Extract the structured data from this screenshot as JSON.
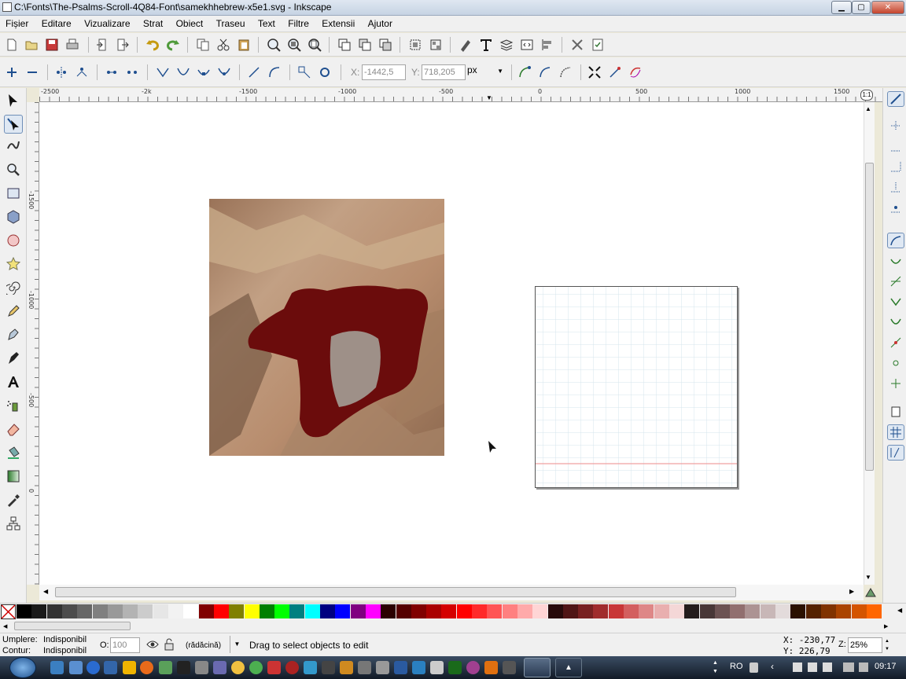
{
  "window": {
    "title": "C:\\Fonts\\The-Psalms-Scroll-4Q84-Font\\samekhhebrew-x5e1.svg - Inkscape",
    "min": "▁",
    "max": "▢",
    "close": "✕"
  },
  "menu": [
    "Fișier",
    "Editare",
    "Vizualizare",
    "Strat",
    "Obiect",
    "Traseu",
    "Text",
    "Filtre",
    "Extensii",
    "Ajutor"
  ],
  "node_toolbar": {
    "x_label": "X:",
    "x_value": "-1442,5",
    "y_label": "Y:",
    "y_value": "718,205",
    "unit": "px"
  },
  "ruler_top": [
    "-2500",
    "-2k",
    "-1500",
    "-1000",
    "-500",
    "0",
    "500",
    "1000",
    "1500"
  ],
  "ruler_left": [
    "-1500",
    "-1000",
    "-500",
    "0"
  ],
  "palette_colors": [
    "#000000",
    "#1a1a1a",
    "#333333",
    "#4d4d4d",
    "#666666",
    "#808080",
    "#999999",
    "#b3b3b3",
    "#cccccc",
    "#e6e6e6",
    "#f2f2f2",
    "#ffffff",
    "#800000",
    "#ff0000",
    "#808000",
    "#ffff00",
    "#008000",
    "#00ff00",
    "#008080",
    "#00ffff",
    "#000080",
    "#0000ff",
    "#800080",
    "#ff00ff",
    "#2b0000",
    "#550000",
    "#800000",
    "#aa0000",
    "#d40000",
    "#ff0000",
    "#ff2a2a",
    "#ff5555",
    "#ff8080",
    "#ffaaaa",
    "#ffd5d5",
    "#280b0b",
    "#501616",
    "#782121",
    "#a02c2c",
    "#c83737",
    "#d35f5f",
    "#de8787",
    "#e9afaf",
    "#f4d7d7",
    "#241c1c",
    "#483737",
    "#6c5353",
    "#916f6f",
    "#ac9393",
    "#c8b7b7",
    "#e3dbdb",
    "#2b1100",
    "#552200",
    "#803300",
    "#aa4400",
    "#d45500",
    "#ff6600"
  ],
  "status": {
    "fill_label": "Umplere:",
    "fill_value": "Indisponibil",
    "stroke_label": "Contur:",
    "stroke_value": "Indisponibil",
    "opacity_label": "O:",
    "opacity_value": "100",
    "layer": "(rădăcină)",
    "message": "Drag to select objects to edit",
    "x_readout": "X: -230,77",
    "y_readout": "Y:  226,79",
    "zoom_label": "Z:",
    "zoom_value": "25%"
  },
  "taskbar": {
    "lang": "RO",
    "time": "09:17"
  },
  "colors": {
    "glyph_fill": "#6b0c0c",
    "grid_line": "#d5e4ec",
    "baseline": "#f0a0a0",
    "taskbar": "#1e2a3a"
  }
}
